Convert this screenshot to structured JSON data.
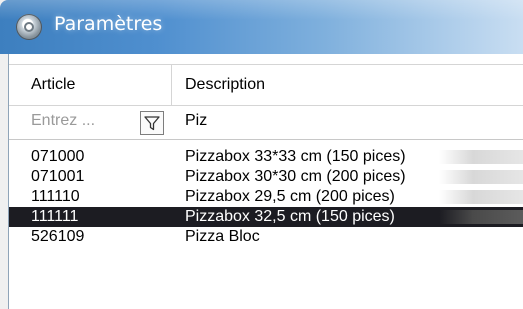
{
  "window": {
    "title": "Paramètres"
  },
  "grid": {
    "columns": [
      "Article",
      "Description"
    ],
    "filter": {
      "article_placeholder": "Entrez ...",
      "description_value": "Piz"
    },
    "rows": [
      {
        "article": "071000",
        "description": "Pizzabox 33*33 cm (150 pices)",
        "selected": false
      },
      {
        "article": "071001",
        "description": "Pizzabox 30*30 cm (200 pices)",
        "selected": false
      },
      {
        "article": "111110",
        "description": "Pizzabox 29,5 cm (200 pices)",
        "selected": false
      },
      {
        "article": "111111",
        "description": "Pizzabox 32,5 cm (150 pices)",
        "selected": true
      },
      {
        "article": "526109",
        "description": "Pizza Bloc",
        "selected": false
      }
    ]
  },
  "icons": {
    "app": "settings-icon",
    "filter": "filter-icon"
  },
  "colors": {
    "titlebar": "#4f8fcf",
    "selected_row": "#1c1c22"
  }
}
